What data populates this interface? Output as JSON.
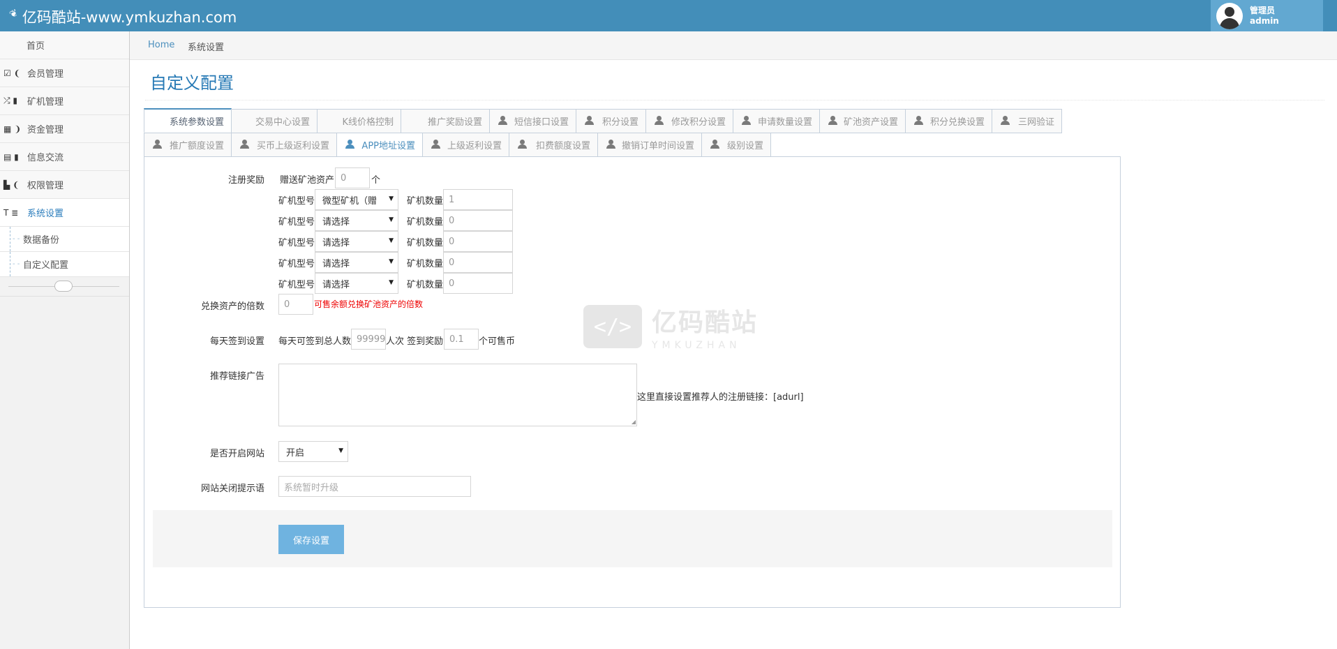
{
  "header": {
    "brand": "亿码酷站-www.ymkuzhan.com",
    "user_role": "管理员",
    "user_name": "admin",
    "accent": "#438eb9"
  },
  "sidebar": {
    "items": [
      {
        "label": "首页",
        "icon": "home"
      },
      {
        "label": "会员管理",
        "icon": "edit-icon"
      },
      {
        "label": "矿机管理",
        "icon": "random-icon"
      },
      {
        "label": "资金管理",
        "icon": "calendar-icon"
      },
      {
        "label": "信息交流",
        "icon": "list-icon"
      },
      {
        "label": "权限管理",
        "icon": "file-icon"
      },
      {
        "label": "系统设置",
        "icon": "text-icon"
      }
    ],
    "subitems": [
      {
        "label": "数据备份"
      },
      {
        "label": "自定义配置"
      }
    ]
  },
  "breadcrumb": {
    "home": "Home",
    "current": "系统设置"
  },
  "page": {
    "title": "自定义配置"
  },
  "tabs": {
    "row1": [
      "系统参数设置",
      "交易中心设置",
      "K线价格控制",
      "推广奖励设置",
      "短信接口设置",
      "积分设置",
      "修改积分设置",
      "申请数量设置",
      "矿池资产设置",
      "积分兑换设置",
      "三网验证"
    ],
    "row2": [
      "推广额度设置",
      "买币上级返利设置",
      "APP地址设置",
      "上级返利设置",
      "扣费额度设置",
      "撤销订单时间设置",
      "级别设置"
    ]
  },
  "form": {
    "reg_reward": {
      "label": "注册奖励",
      "gift_text": "赠送矿池资产",
      "gift_value": "0",
      "unit": "个"
    },
    "miners": [
      {
        "model_label": "矿机型号",
        "model": "微型矿机（赠",
        "count_label": "矿机数量",
        "count": "1"
      },
      {
        "model_label": "矿机型号",
        "model": "请选择",
        "count_label": "矿机数量",
        "count": "0"
      },
      {
        "model_label": "矿机型号",
        "model": "请选择",
        "count_label": "矿机数量",
        "count": "0"
      },
      {
        "model_label": "矿机型号",
        "model": "请选择",
        "count_label": "矿机数量",
        "count": "0"
      },
      {
        "model_label": "矿机型号",
        "model": "请选择",
        "count_label": "矿机数量",
        "count": "0"
      }
    ],
    "exchange": {
      "label": "兑换资产的倍数",
      "value": "0",
      "hint": "可售余额兑换矿池资产的倍数"
    },
    "checkin": {
      "label": "每天签到设置",
      "text1": "每天可签到总人数",
      "total": "99999",
      "text2": "人次 签到奖励",
      "reward": "0.1",
      "text3": "个可售币"
    },
    "ad": {
      "label": "推荐链接广告",
      "hint": "这里直接设置推荐人的注册链接：[adurl]"
    },
    "site_open": {
      "label": "是否开启网站",
      "value": "开启"
    },
    "close_msg": {
      "label": "网站关闭提示语",
      "placeholder": "系统暂时升级"
    },
    "save": "保存设置"
  },
  "watermark": {
    "symbol": "</>",
    "name": "亿码酷站",
    "sub": "YMKUZHAN"
  }
}
